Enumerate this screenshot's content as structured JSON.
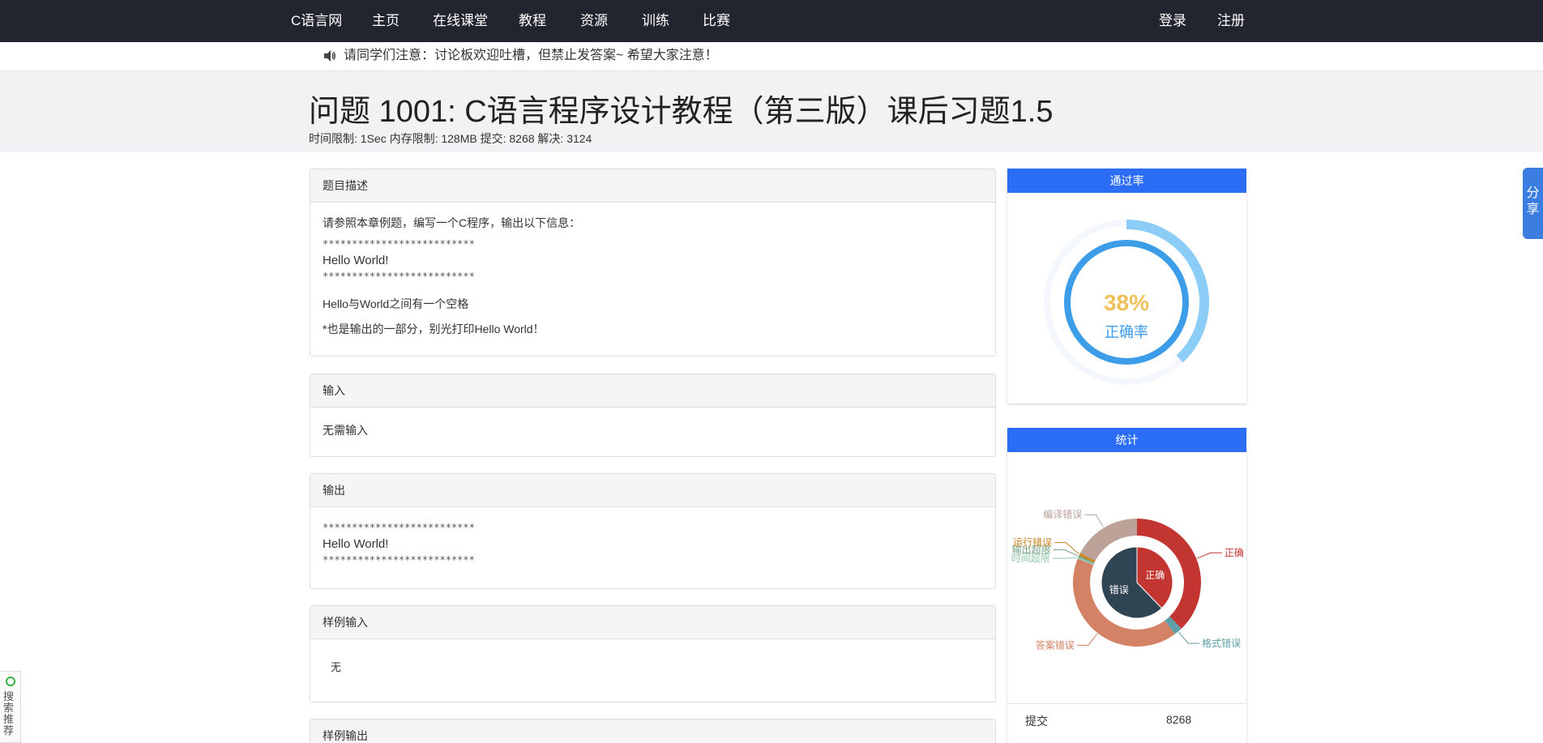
{
  "nav": {
    "brand": "C语言网",
    "items": [
      "主页",
      "在线课堂",
      "教程",
      "资源",
      "训练",
      "比赛"
    ],
    "login": "登录",
    "register": "注册"
  },
  "notice": {
    "text": "请同学们注意：讨论板欢迎吐槽，但禁止发答案~ 希望大家注意！"
  },
  "problem": {
    "title": "问题 1001: C语言程序设计教程（第三版）课后习题1.5",
    "meta": "时间限制: 1Sec 内存限制: 128MB 提交: 8268 解决: 3124"
  },
  "sections": {
    "description": {
      "header": "题目描述",
      "intro": "请参照本章例题，编写一个C程序，输出以下信息：",
      "stars1": "**************************",
      "hello": "Hello World!",
      "stars2": "**************************",
      "note1": "Hello与World之间有一个空格",
      "note2": "*也是输出的一部分，别光打印Hello World！"
    },
    "input": {
      "header": "输入",
      "body": "无需输入"
    },
    "output": {
      "header": "输出",
      "stars1": "**************************",
      "hello": "Hello World!",
      "stars2": "**************************"
    },
    "sample_input": {
      "header": "样例输入",
      "body": "无"
    },
    "sample_output": {
      "header": "样例输出"
    }
  },
  "pass_rate": {
    "header": "通过率",
    "percent_text": "38%",
    "label": "正确率",
    "value": 0.38
  },
  "stats": {
    "header": "统计",
    "rows": [
      {
        "key": "提交",
        "value": "8268"
      }
    ]
  },
  "chart_data": {
    "type": "pie",
    "inner": [
      {
        "name": "正确",
        "value": 3124
      },
      {
        "name": "错误",
        "value": 5144
      }
    ],
    "outer": [
      {
        "name": "正确",
        "value": 3124
      },
      {
        "name": "格式错误",
        "value": 180
      },
      {
        "name": "答案错误",
        "value": 3400
      },
      {
        "name": "时间超限",
        "value": 40
      },
      {
        "name": "输出超限",
        "value": 30
      },
      {
        "name": "运行错误",
        "value": 60
      },
      {
        "name": "编译错误",
        "value": 1434
      }
    ]
  },
  "colors": {
    "navbar": "#22252f",
    "accent_blue": "#2b6ef5",
    "correct": "#c23531",
    "wrong_inner": "#2f4554",
    "format_error": "#61a0a8",
    "wrong_answer": "#d48265",
    "time_limit": "#91c7ae",
    "output_limit": "#749f83",
    "runtime_error": "#ca8622",
    "compile_error": "#bda29a",
    "gauge_percent": "#f0c05a",
    "gauge_label": "#3b9be8"
  },
  "share": {
    "label": "分享"
  },
  "search_widget": {
    "label": "搜索推荐"
  },
  "icons": {
    "speaker": "speaker-icon",
    "search_logo": "search-logo-icon"
  }
}
